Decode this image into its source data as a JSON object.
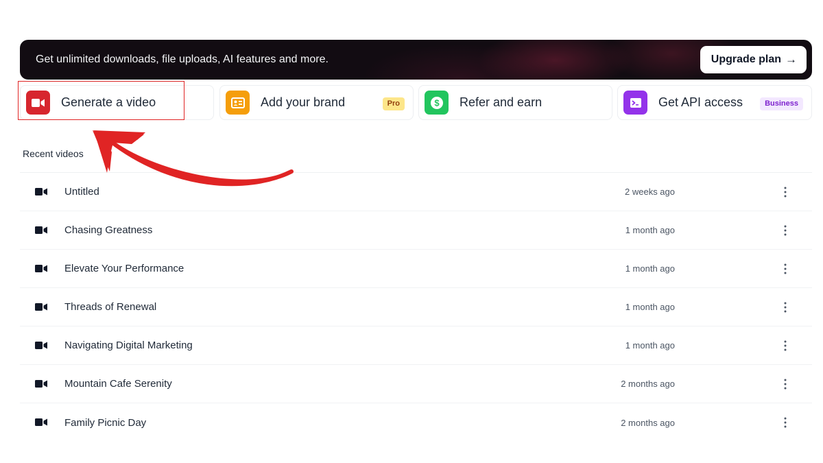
{
  "banner": {
    "text": "Get unlimited downloads, file uploads, AI features and more.",
    "upgrade_label": "Upgrade plan",
    "upgrade_arrow": "→"
  },
  "actions": [
    {
      "label": "Generate a video",
      "icon": "video-camera-icon",
      "color": "#d7262e"
    },
    {
      "label": "Add your brand",
      "icon": "id-card-icon",
      "color": "#f59e0b",
      "badge": "Pro"
    },
    {
      "label": "Refer and earn",
      "icon": "dollar-coin-icon",
      "color": "#22c55e"
    },
    {
      "label": "Get API access",
      "icon": "terminal-icon",
      "color": "#9333ea",
      "badge": "Business"
    }
  ],
  "recent": {
    "title": "Recent videos",
    "items": [
      {
        "title": "Untitled",
        "time": "2 weeks ago"
      },
      {
        "title": "Chasing Greatness",
        "time": "1 month ago"
      },
      {
        "title": "Elevate Your Performance",
        "time": "1 month ago"
      },
      {
        "title": "Threads of Renewal",
        "time": "1 month ago"
      },
      {
        "title": "Navigating Digital Marketing",
        "time": "1 month ago"
      },
      {
        "title": "Mountain Cafe Serenity",
        "time": "2 months ago"
      },
      {
        "title": "Family Picnic Day",
        "time": "2 months ago"
      }
    ]
  },
  "annotation": {
    "color": "#e02424"
  }
}
